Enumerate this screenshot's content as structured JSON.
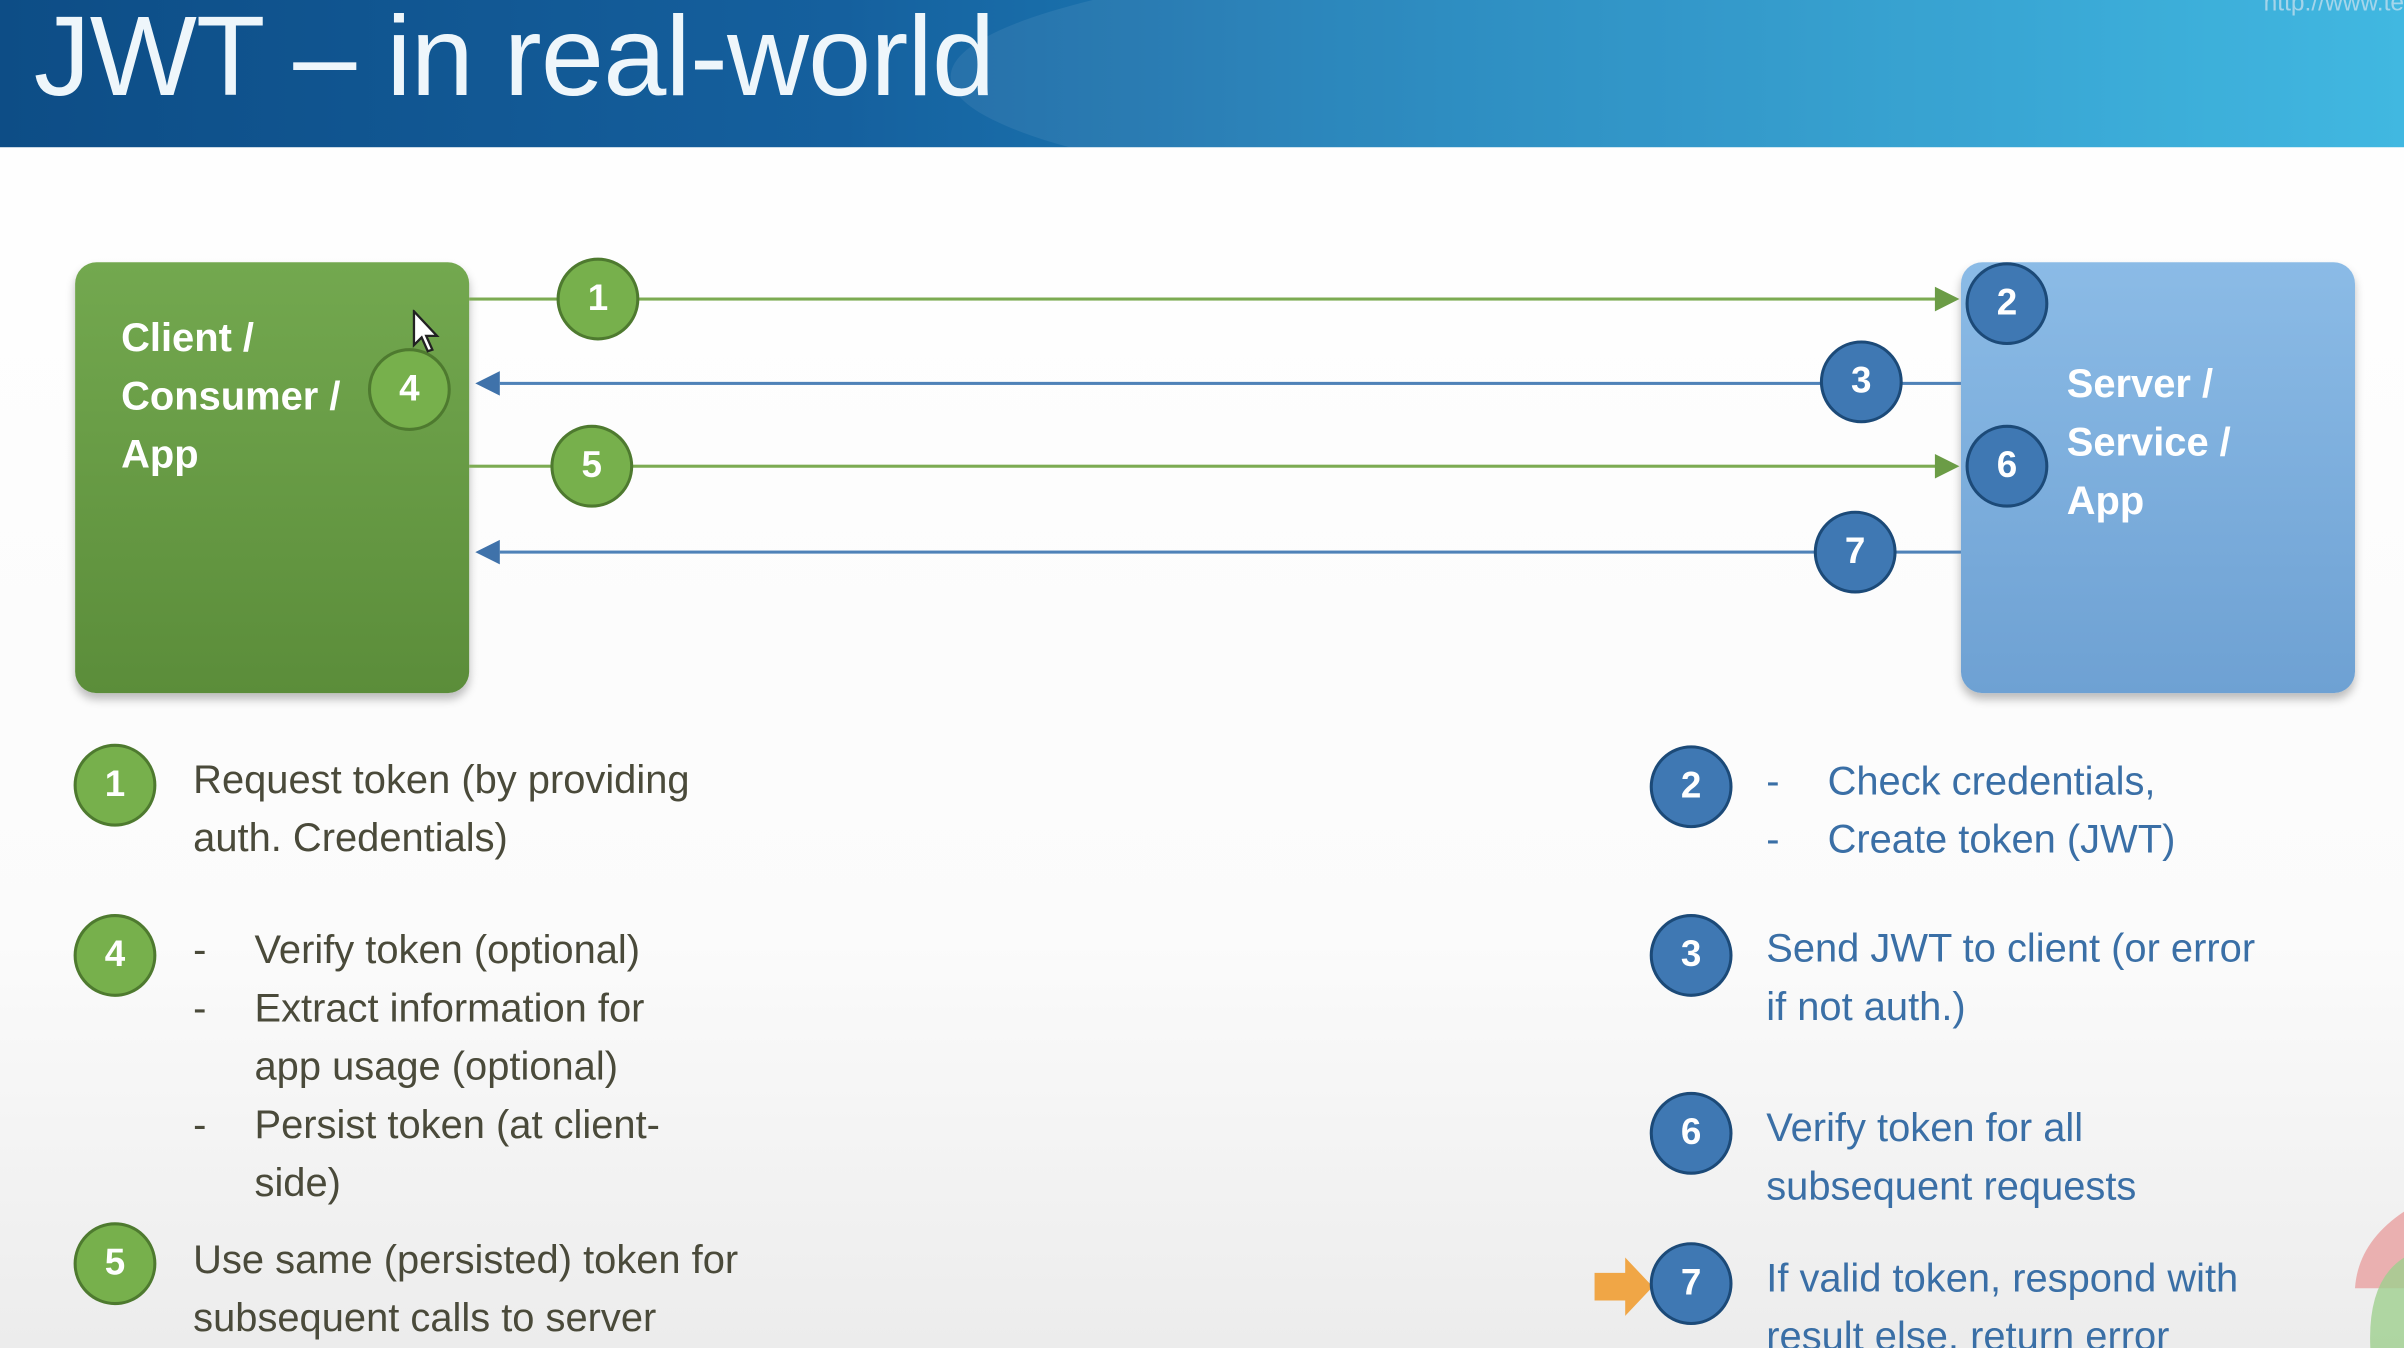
{
  "title": "JWT – in real-world",
  "url_text": "http://www.te",
  "client_label": [
    "Client /",
    "Consumer /",
    "App"
  ],
  "server_label": [
    "Server /",
    "Service /",
    "App"
  ],
  "steps": {
    "s1": "1",
    "s2": "2",
    "s3": "3",
    "s4": "4",
    "s5": "5",
    "s6": "6",
    "s7": "7"
  },
  "bullet": "-",
  "left_desc": {
    "d1": [
      "Request token (by providing",
      "auth. Credentials)"
    ],
    "d4": [
      "Verify token (optional)",
      "Extract information for",
      "app usage (optional)",
      "Persist token (at client-",
      "side)"
    ],
    "d5": [
      "Use same (persisted) token for",
      "subsequent calls to server"
    ]
  },
  "right_desc": {
    "d2": [
      "Check credentials,",
      "Create token (JWT)"
    ],
    "d3": [
      "Send JWT to client (or error",
      "if not auth.)"
    ],
    "d6": [
      "Verify token for all",
      "subsequent requests"
    ],
    "d7": [
      "If valid token, respond with",
      "result else, return error"
    ]
  },
  "colors": {
    "green": "#77b04c",
    "blue": "#3f78b3",
    "client_box": "#5b8d3a",
    "server_box": "#6ea1d3",
    "header": "#15609e"
  }
}
